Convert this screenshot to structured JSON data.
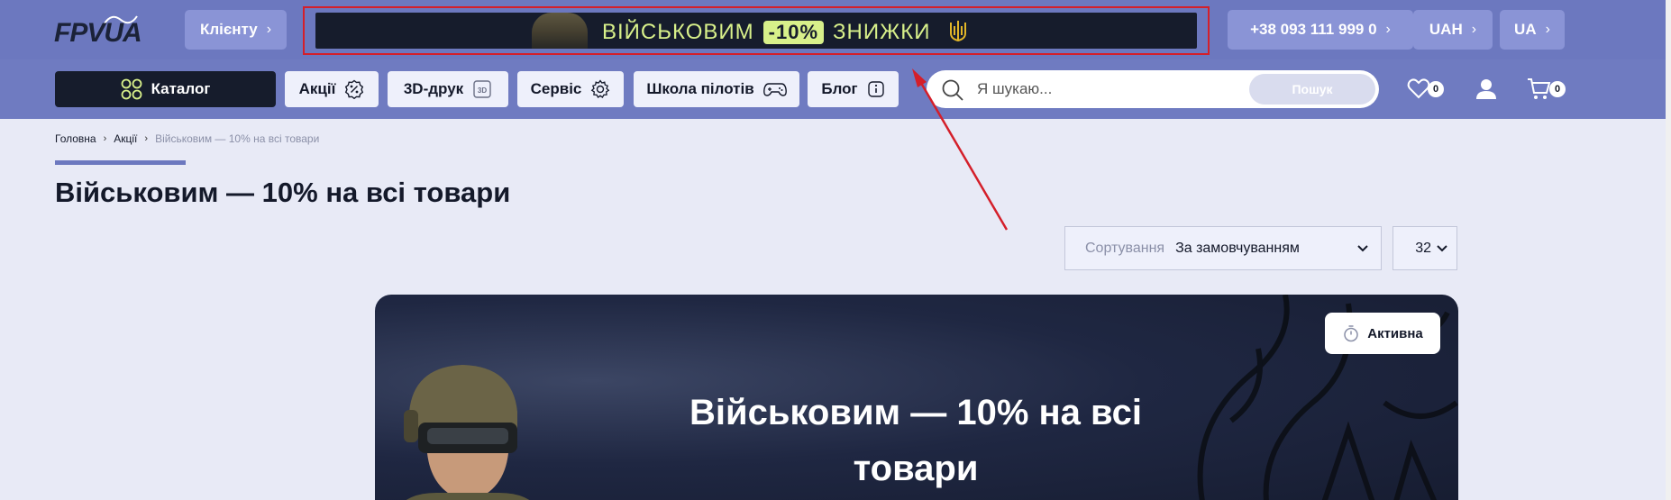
{
  "header": {
    "logo": "FPVUA",
    "client_label": "Клієнту",
    "promo": {
      "text_before": "ВІЙСЬКОВИМ",
      "badge": "-10%",
      "text_after": "ЗНИЖКИ"
    },
    "phone": "+38 093 111 999 0",
    "currency": "UAH",
    "language": "UA"
  },
  "nav": {
    "catalog": "Каталог",
    "items": [
      {
        "label": "Акції",
        "icon": "percent-badge-icon"
      },
      {
        "label": "3D-друк",
        "icon": "3d-icon"
      },
      {
        "label": "Сервіс",
        "icon": "gear-icon"
      },
      {
        "label": "Школа пілотів",
        "icon": "gamepad-icon"
      },
      {
        "label": "Блог",
        "icon": "info-icon"
      }
    ],
    "search_placeholder": "Я шукаю...",
    "search_button": "Пошук",
    "wishlist_count": "0",
    "cart_count": "0"
  },
  "breadcrumb": [
    "Головна",
    "Акції",
    "Військовим — 10% на всі товари"
  ],
  "page_title": "Військовим — 10% на всі товари",
  "sort": {
    "label": "Сортування",
    "value": "За замовчуванням",
    "per_page": "32"
  },
  "hero": {
    "title": "Військовим — 10% на всі товари",
    "status": "Активна"
  },
  "colors": {
    "header": "#6c78bf",
    "dark": "#161c2c",
    "accent_green": "#d8f08a",
    "annotation": "#d41f2a"
  }
}
